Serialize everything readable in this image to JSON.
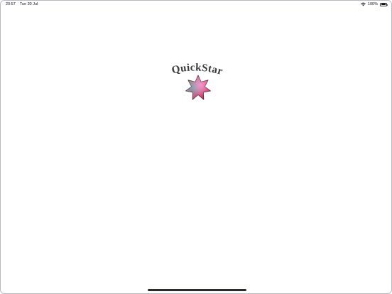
{
  "status_bar": {
    "time": "20:57",
    "date": "Tue 30 Jul",
    "battery_percent": "100%",
    "wifi_icon": "wifi-icon",
    "battery_icon": "battery-full-icon"
  },
  "logo": {
    "title": "QuickStar",
    "icon": "seven-point-star-icon"
  },
  "colors": {
    "background": "#ffffff",
    "logo_text": "#3a3a3a",
    "star_pink": "#ff3a7a",
    "star_gold": "#b89a2a",
    "star_teal": "#4ab8b0"
  }
}
